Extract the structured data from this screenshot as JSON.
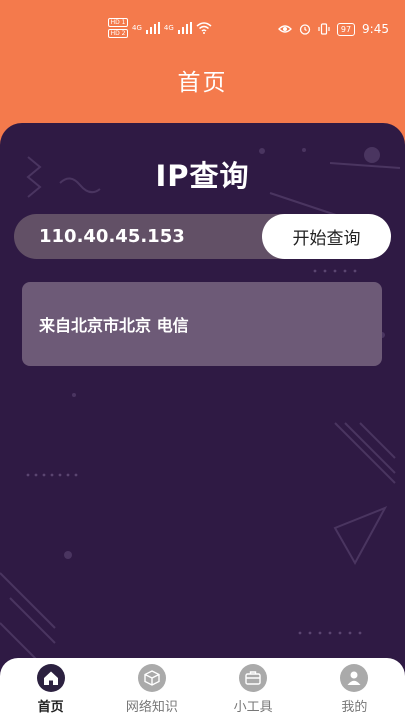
{
  "status_bar": {
    "sim1": "HD 1",
    "sim2": "HD 2",
    "network1": "4G",
    "network2": "4G",
    "battery": "97",
    "time": "9:45",
    "icons": [
      "eye-icon",
      "alarm-icon",
      "vibrate-icon",
      "battery-icon",
      "wifi-icon",
      "signal-icon"
    ]
  },
  "header": {
    "title": "首页"
  },
  "main": {
    "title": "IP查询",
    "ip_value": "110.40.45.153",
    "search_button": "开始查询",
    "result": "来自北京市北京 电信"
  },
  "tabs": [
    {
      "label": "首页",
      "icon": "home-icon",
      "active": true
    },
    {
      "label": "网络知识",
      "icon": "box-icon",
      "active": false
    },
    {
      "label": "小工具",
      "icon": "toolbox-icon",
      "active": false
    },
    {
      "label": "我的",
      "icon": "user-icon",
      "active": false
    }
  ],
  "colors": {
    "header_bg": "#f47a4c",
    "main_bg": "#2f1a44",
    "input_bg": "#625066",
    "card_bg": "#6d5a77",
    "tab_active": "#2c2140"
  }
}
